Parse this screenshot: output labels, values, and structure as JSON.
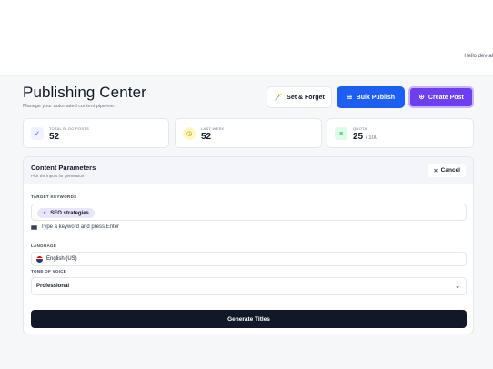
{
  "header": {
    "greeting": "Hello dev-al"
  },
  "page": {
    "title": "Publishing Center",
    "subtitle": "Manage your automated content pipeline."
  },
  "actions": {
    "set_forget": {
      "label": "Set & Forget",
      "icon": "magic-wand-icon"
    },
    "bulk_publish": {
      "label": "Bulk Publish",
      "icon": "stack-icon"
    },
    "create_post": {
      "label": "Create Post",
      "icon": "plus-circle-icon"
    }
  },
  "stats": [
    {
      "label": "TOTAL BLOG POSTS",
      "value": "52",
      "icon": "check-icon"
    },
    {
      "label": "LAST WEEK",
      "value": "52",
      "icon": "clock-icon"
    },
    {
      "label": "QUOTA",
      "value": "25",
      "suffix": "/ 100",
      "icon": "database-icon"
    }
  ],
  "form": {
    "title": "Content Parameters",
    "subtitle": "Pick the inputs for generation",
    "cancel_label": "Cancel",
    "keywords_label": "TARGET KEYWORDS",
    "keyword_chips": [
      "SEO strategies"
    ],
    "keyword_hint": "Type a keyword and press Enter",
    "language_label": "LANGUAGE",
    "language_value": "English (US)",
    "tone_label": "TONE OF VOICE",
    "tone_value": "Professional",
    "generate_label": "Generate Titles"
  },
  "colors": {
    "primary": "#1d5ff2",
    "accent": "#6d3ff0",
    "dark": "#111827"
  }
}
